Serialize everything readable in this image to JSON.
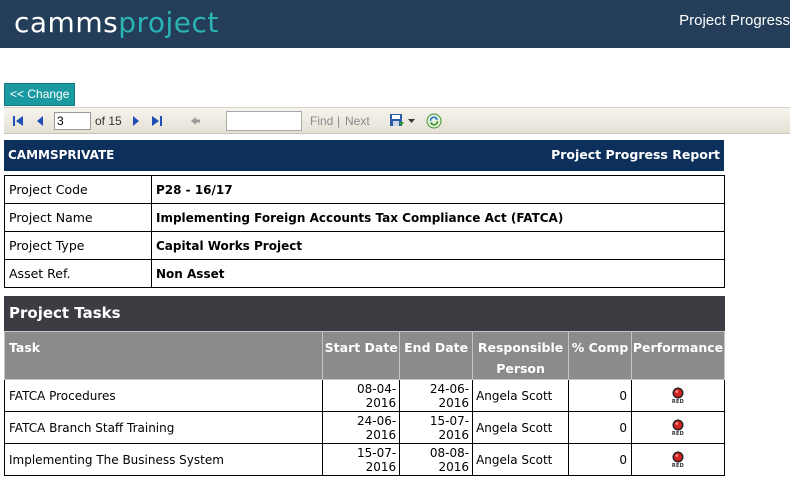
{
  "header": {
    "logo_part1": "camms",
    "logo_part2": "project",
    "page_title": "Project Progress"
  },
  "change_button": {
    "label": "<< Change"
  },
  "toolbar": {
    "current_page": "3",
    "of_text": "of 15",
    "find_label": "Find",
    "separator": "|",
    "next_label": "Next"
  },
  "report": {
    "organization": "CAMMSPRIVATE",
    "title": "Project Progress Report"
  },
  "project_info": [
    {
      "label": "Project Code",
      "value": "P28 - 16/17"
    },
    {
      "label": "Project Name",
      "value": "Implementing Foreign Accounts Tax Compliance Act (FATCA)"
    },
    {
      "label": "Project Type",
      "value": "Capital Works Project"
    },
    {
      "label": "Asset Ref.",
      "value": "Non Asset"
    }
  ],
  "tasks": {
    "section_title": "Project Tasks",
    "columns": {
      "task": "Task",
      "start": "Start Date",
      "end": "End Date",
      "responsible": "Responsible Person",
      "pct": "% Comp",
      "performance": "Performance"
    },
    "rows": [
      {
        "task": "FATCA Procedures",
        "start": "08-04-2016",
        "end": "24-06-2016",
        "responsible": "Angela Scott",
        "pct": "0",
        "performance": "RED"
      },
      {
        "task": "FATCA Branch Staff Training",
        "start": "24-06-2016",
        "end": "15-07-2016",
        "responsible": "Angela Scott",
        "pct": "0",
        "performance": "RED"
      },
      {
        "task": "Implementing The Business System",
        "start": "15-07-2016",
        "end": "08-08-2016",
        "responsible": "Angela Scott",
        "pct": "0",
        "performance": "RED"
      }
    ]
  },
  "colors": {
    "topbar": "#243e59",
    "logo_accent": "#2bb3b6",
    "report_header": "#0d2f5c",
    "tasks_title": "#3c3d42",
    "tasks_header": "#8b8b8b",
    "status_red": "#d82020"
  },
  "icons": {
    "first_page": "first-page-icon",
    "prev_page": "previous-page-icon",
    "next_page": "next-page-icon",
    "last_page": "last-page-icon",
    "back": "back-arrow-icon",
    "export": "save-export-icon",
    "refresh": "refresh-icon",
    "status": "red-status-light-icon"
  }
}
